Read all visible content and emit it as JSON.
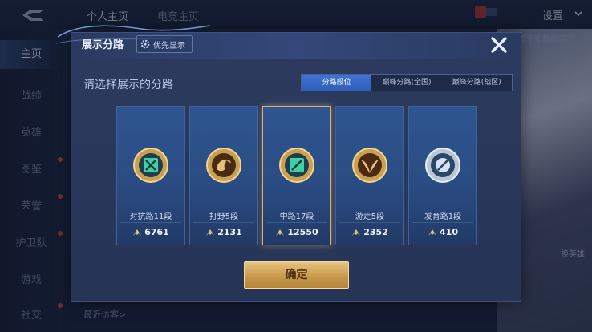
{
  "app": {
    "top_tabs": [
      "个人主页",
      "电竞主页"
    ],
    "settings_label": "设置",
    "settings_sub": "显示和数据展示",
    "nav": [
      {
        "label": "主页",
        "active": true
      },
      {
        "label": "战绩"
      },
      {
        "label": "英雄"
      },
      {
        "label": "图鉴"
      },
      {
        "label": "荣誉"
      },
      {
        "label": "护卫队"
      },
      {
        "label": "游戏"
      },
      {
        "label": "社交"
      }
    ],
    "bottom_link": "最近访客>",
    "hero_button": "换英雄"
  },
  "modal": {
    "title": "展示分路",
    "priority_label": "优先显示",
    "prompt": "请选择展示的分路",
    "tabs": [
      {
        "label": "分路段位",
        "active": true
      },
      {
        "label": "巅峰分路(全国)"
      },
      {
        "label": "巅峰分路(战区)"
      }
    ],
    "cards": [
      {
        "name": "对抗路11段",
        "score": "6761",
        "selected": false
      },
      {
        "name": "打野5段",
        "score": "2131",
        "selected": false
      },
      {
        "name": "中路17段",
        "score": "12550",
        "selected": true
      },
      {
        "name": "游走5段",
        "score": "2352",
        "selected": false
      },
      {
        "name": "发育路1段",
        "score": "410",
        "selected": false
      }
    ],
    "confirm_label": "确定",
    "colors": {
      "gold": "#d9b277",
      "tab_active": "#3f74d4",
      "card": "#2a4c83"
    }
  }
}
